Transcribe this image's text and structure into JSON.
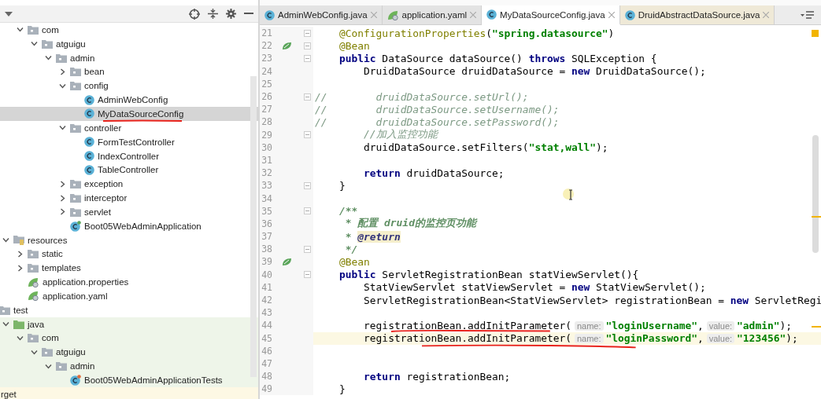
{
  "project_tree": [
    {
      "children": [
        {
          "children": [
            {
              "label": "com",
              "kind": "package",
              "expanded": true,
              "selected": false,
              "children": [
                {
                  "label": "atguigu",
                  "kind": "package",
                  "expanded": true,
                  "selected": false,
                  "children": [
                    {
                      "label": "admin",
                      "kind": "package",
                      "expanded": true,
                      "selected": false,
                      "children": [
                        {
                          "label": "bean",
                          "kind": "package",
                          "expanded": false,
                          "selected": false
                        },
                        {
                          "label": "config",
                          "kind": "package",
                          "expanded": true,
                          "selected": false,
                          "children": [
                            {
                              "label": "AdminWebConfig",
                              "kind": "class",
                              "selected": false
                            },
                            {
                              "label": "MyDataSourceConfig",
                              "kind": "class",
                              "selected": true,
                              "underlined": true
                            }
                          ]
                        },
                        {
                          "label": "controller",
                          "kind": "package",
                          "expanded": true,
                          "selected": false,
                          "children": [
                            {
                              "label": "FormTestController",
                              "kind": "class",
                              "selected": false
                            },
                            {
                              "label": "IndexController",
                              "kind": "class",
                              "selected": false
                            },
                            {
                              "label": "TableController",
                              "kind": "class",
                              "selected": false
                            }
                          ]
                        },
                        {
                          "label": "exception",
                          "kind": "package",
                          "expanded": false,
                          "selected": false
                        },
                        {
                          "label": "interceptor",
                          "kind": "package",
                          "expanded": false,
                          "selected": false
                        },
                        {
                          "label": "servlet",
                          "kind": "package",
                          "expanded": false,
                          "selected": false
                        },
                        {
                          "label": "Boot05WebAdminApplication",
                          "kind": "app",
                          "selected": false
                        }
                      ]
                    }
                  ]
                }
              ]
            }
          ]
        },
        {
          "label": "resources",
          "kind": "resources",
          "expanded": true,
          "selected": false,
          "children": [
            {
              "label": "static",
              "kind": "package",
              "expanded": false,
              "selected": false
            },
            {
              "label": "templates",
              "kind": "package",
              "expanded": false,
              "selected": false
            },
            {
              "label": "application.properties",
              "kind": "config",
              "selected": false
            },
            {
              "label": "application.yaml",
              "kind": "config",
              "selected": false
            }
          ]
        }
      ]
    },
    {
      "label": "test",
      "kind": "package",
      "selected": false,
      "children": [
        {
          "label": "java",
          "kind": "testroot",
          "expanded": true,
          "selected": false,
          "test_source": true,
          "children": [
            {
              "label": "com",
              "kind": "package",
              "expanded": true,
              "selected": false,
              "test_source": true,
              "children": [
                {
                  "label": "atguigu",
                  "kind": "package",
                  "expanded": true,
                  "selected": false,
                  "test_source": true,
                  "children": [
                    {
                      "label": "admin",
                      "kind": "package",
                      "expanded": true,
                      "selected": false,
                      "test_source": true,
                      "children": [
                        {
                          "label": "Boot05WebAdminApplicationTests",
                          "kind": "test",
                          "selected": false,
                          "test_source": true
                        }
                      ]
                    }
                  ]
                }
              ]
            }
          ]
        }
      ]
    },
    {
      "label": "rget",
      "selected": false,
      "excluded": true
    }
  ],
  "tabs": [
    {
      "label": "AdminWebConfig.java",
      "kind": "class",
      "selected": false,
      "library": false
    },
    {
      "label": "application.yaml",
      "kind": "config",
      "selected": false,
      "library": false
    },
    {
      "label": "MyDataSourceConfig.java",
      "kind": "class",
      "selected": true,
      "library": false
    },
    {
      "label": "DruidAbstractDataSource.java",
      "kind": "class",
      "selected": false,
      "library": true
    }
  ],
  "code_lines": [
    {
      "n": "21",
      "fold": true,
      "parts": [
        {
          "t": "    @ConfigurationProperties",
          "kind": "ann"
        },
        {
          "t": "("
        },
        {
          "t": "\"spring.datasource\"",
          "kind": "str"
        },
        {
          "t": ")"
        }
      ]
    },
    {
      "n": "22",
      "fold": true,
      "bean_marker": true,
      "parts": [
        {
          "t": "    @Bean",
          "kind": "ann"
        }
      ]
    },
    {
      "n": "23",
      "fold": true,
      "parts": [
        {
          "t": "    public",
          "kind": "kw"
        },
        {
          "t": " DataSource dataSource() "
        },
        {
          "t": "throws",
          "kind": "kw"
        },
        {
          "t": " SQLException {"
        }
      ]
    },
    {
      "n": "24",
      "parts": [
        {
          "t": "        DruidDataSource druidDataSource = "
        },
        {
          "t": "new",
          "kind": "kw"
        },
        {
          "t": " DruidDataSource();"
        }
      ]
    },
    {
      "n": "25"
    },
    {
      "n": "26",
      "fold": true,
      "parts": [
        {
          "t": "//        druidDataSource.setUrl();",
          "kind": "comment"
        }
      ]
    },
    {
      "n": "27",
      "parts": [
        {
          "t": "//        druidDataSource.setUsername();",
          "kind": "comment"
        }
      ]
    },
    {
      "n": "28",
      "parts": [
        {
          "t": "//        druidDataSource.setPassword();",
          "kind": "comment"
        }
      ]
    },
    {
      "n": "29",
      "fold": true,
      "parts": [
        {
          "t": "        //加入监控功能",
          "kind": "comment"
        }
      ]
    },
    {
      "n": "30",
      "parts": [
        {
          "t": "        druidDataSource.setFilters("
        },
        {
          "t": "\"stat,wall\"",
          "kind": "str"
        },
        {
          "t": ");"
        }
      ]
    },
    {
      "n": "31"
    },
    {
      "n": "32",
      "parts": [
        {
          "t": "        return",
          "kind": "kw"
        },
        {
          "t": " druidDataSource;"
        }
      ]
    },
    {
      "n": "33",
      "fold": true,
      "parts": [
        {
          "t": "    }"
        }
      ]
    },
    {
      "n": "34"
    },
    {
      "n": "35",
      "fold": true,
      "parts": [
        {
          "t": "    /**",
          "kind": "doc"
        }
      ]
    },
    {
      "n": "36",
      "parts": [
        {
          "t": "     * 配置 druid的监控页功能",
          "kind": "doc"
        }
      ]
    },
    {
      "n": "37",
      "parts": [
        {
          "t": "     * ",
          "kind": "doc"
        },
        {
          "t": "@return",
          "kind": "doctag"
        }
      ]
    },
    {
      "n": "38",
      "fold": true,
      "parts": [
        {
          "t": "     */",
          "kind": "doc"
        }
      ]
    },
    {
      "n": "39",
      "bean_marker": true,
      "parts": [
        {
          "t": "    @Bean",
          "kind": "ann"
        }
      ]
    },
    {
      "n": "40",
      "fold": true,
      "parts": [
        {
          "t": "    public",
          "kind": "kw"
        },
        {
          "t": " ServletRegistrationBean statViewServlet(){"
        }
      ]
    },
    {
      "n": "41",
      "parts": [
        {
          "t": "        StatViewServlet statViewServlet = "
        },
        {
          "t": "new",
          "kind": "kw"
        },
        {
          "t": " StatViewServlet();"
        }
      ]
    },
    {
      "n": "42",
      "parts": [
        {
          "t": "        ServletRegistrationBean<StatViewServlet> registrationBean = "
        },
        {
          "t": "new",
          "kind": "kw"
        },
        {
          "t": " ServletRegi"
        }
      ]
    },
    {
      "n": "43"
    },
    {
      "n": "44",
      "marked": true,
      "parts": [
        {
          "t": "        registrationBean.addInitParameter("
        },
        {
          "t": "name:",
          "kind": "hint"
        },
        {
          "t": "\"loginUsername\"",
          "kind": "str"
        },
        {
          "t": ","
        },
        {
          "t": "value:",
          "kind": "hint"
        },
        {
          "t": "\"admin\"",
          "kind": "str"
        },
        {
          "t": ");"
        }
      ]
    },
    {
      "n": "45",
      "marked": true,
      "current": true,
      "parts": [
        {
          "t": "        registrationBean.addInitParameter("
        },
        {
          "t": "name:",
          "kind": "hint"
        },
        {
          "t": "\"loginPassword\"",
          "kind": "str"
        },
        {
          "t": ","
        },
        {
          "t": "value:",
          "kind": "hint"
        },
        {
          "t": "\"123456\"",
          "kind": "str"
        },
        {
          "t": ");"
        }
      ]
    },
    {
      "n": "46"
    },
    {
      "n": "47"
    },
    {
      "n": "48",
      "parts": [
        {
          "t": "        return",
          "kind": "kw"
        },
        {
          "t": " registrationBean;"
        }
      ]
    },
    {
      "n": "49",
      "parts": [
        {
          "t": "    }"
        }
      ]
    }
  ]
}
